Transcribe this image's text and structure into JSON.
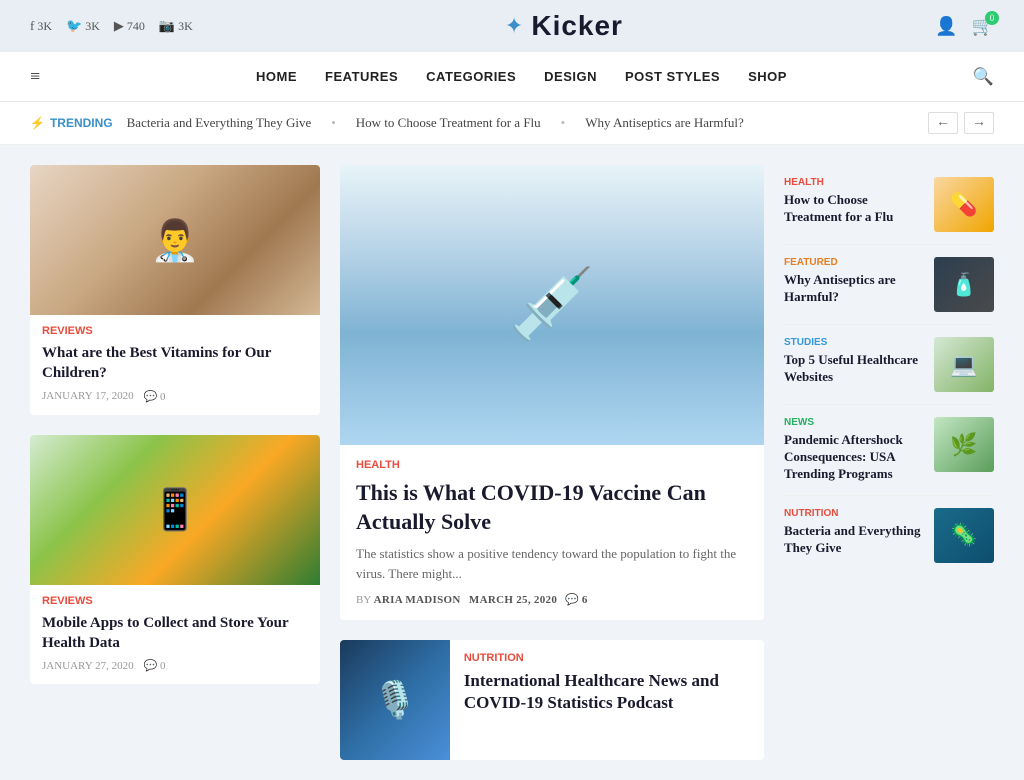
{
  "topBar": {
    "social": [
      {
        "icon": "f",
        "network": "facebook",
        "count": "3K"
      },
      {
        "icon": "🐦",
        "network": "twitter",
        "count": "3K"
      },
      {
        "icon": "▶",
        "network": "youtube",
        "count": "740"
      },
      {
        "icon": "📷",
        "network": "instagram",
        "count": "3K"
      }
    ],
    "logo": "Kicker",
    "cart_count": "0"
  },
  "nav": {
    "hamburger": "≡",
    "links": [
      "HOME",
      "FEATURES",
      "CATEGORIES",
      "DESIGN",
      "POST STYLES",
      "SHOP"
    ]
  },
  "trending": {
    "label": "TRENDING",
    "items": [
      "Bacteria and Everything They Give",
      "How to Choose Treatment for a Flu",
      "Why Antiseptics are Harmful?"
    ]
  },
  "leftSidebar": {
    "articles": [
      {
        "category": "REVIEWS",
        "title": "What are the Best Vitamins for Our Children?",
        "date": "JANUARY 17, 2020",
        "comments": "0"
      },
      {
        "category": "REVIEWS",
        "title": "Mobile Apps to Collect and Store Your Health Data",
        "date": "JANUARY 27, 2020",
        "comments": "0"
      }
    ]
  },
  "featured": {
    "category": "HEALTH",
    "title": "This is What COVID-19 Vaccine Can Actually Solve",
    "excerpt": "The statistics show a positive tendency toward the population to fight the virus. There might...",
    "author": "ARIA MADISON",
    "date": "MARCH 25, 2020",
    "comments": "6"
  },
  "secondArticle": {
    "category": "NUTRITION",
    "title": "International Healthcare News and COVID-19 Statistics Podcast"
  },
  "rightSidebar": {
    "items": [
      {
        "category": "HEALTH",
        "title": "How to Choose Treatment for a Flu",
        "thumb_type": "health"
      },
      {
        "category": "FEATURED",
        "title": "Why Antiseptics are Harmful?",
        "thumb_type": "featured"
      },
      {
        "category": "STUDIES",
        "title": "Top 5 Useful Healthcare Websites",
        "thumb_type": "studies"
      },
      {
        "category": "NEWS",
        "title": "Pandemic Aftershock Consequences: USA Trending Programs",
        "thumb_type": "news"
      },
      {
        "category": "NUTRITION",
        "title": "Bacteria and Everything They Give",
        "thumb_type": "nutrition"
      }
    ]
  }
}
